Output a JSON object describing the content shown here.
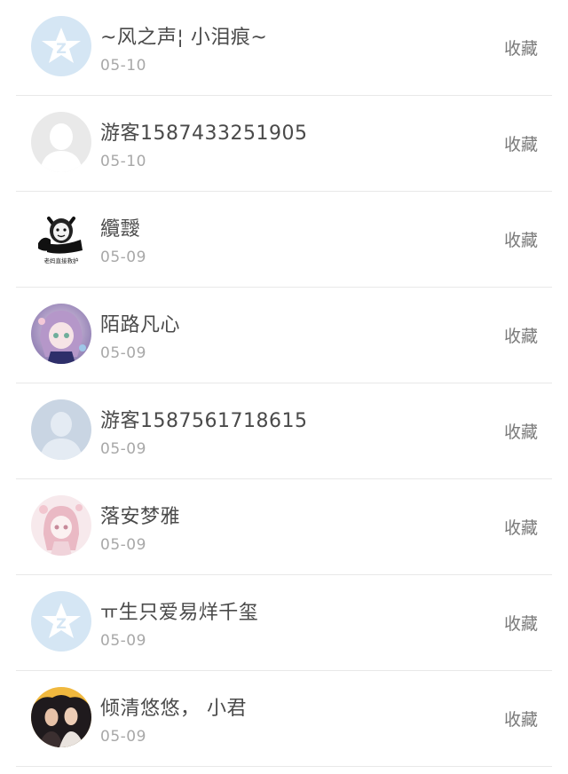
{
  "rows": [
    {
      "name": "~风之声¦ 小泪痕~",
      "date": "05-10",
      "action": "收藏",
      "avatar": "qq-star-icon"
    },
    {
      "name": "游客1587433251905",
      "date": "05-10",
      "action": "收藏",
      "avatar": "default-user-icon"
    },
    {
      "name": "纜靉",
      "date": "05-09",
      "action": "收藏",
      "avatar": "meme-face-avatar",
      "avatar_caption": "老妈直接救护"
    },
    {
      "name": "陌路凡心",
      "date": "05-09",
      "action": "收藏",
      "avatar": "anime-girl-avatar"
    },
    {
      "name": "游客1587561718615",
      "date": "05-09",
      "action": "收藏",
      "avatar": "guest-silhouette-icon"
    },
    {
      "name": "落安梦雅",
      "date": "05-09",
      "action": "收藏",
      "avatar": "pink-anime-avatar"
    },
    {
      "name": "ㅠ生只爱易烊千玺",
      "date": "05-09",
      "action": "收藏",
      "avatar": "qq-star-icon"
    },
    {
      "name": "倾清悠悠， 小君",
      "date": "05-09",
      "action": "收藏",
      "avatar": "photo-avatar"
    }
  ],
  "colors": {
    "name": "#4a4a4a",
    "date": "#a8a8a8",
    "action": "#7a7a7a",
    "divider": "#e8e8e8",
    "qq_avatar_bg": "#d5e6f4"
  }
}
